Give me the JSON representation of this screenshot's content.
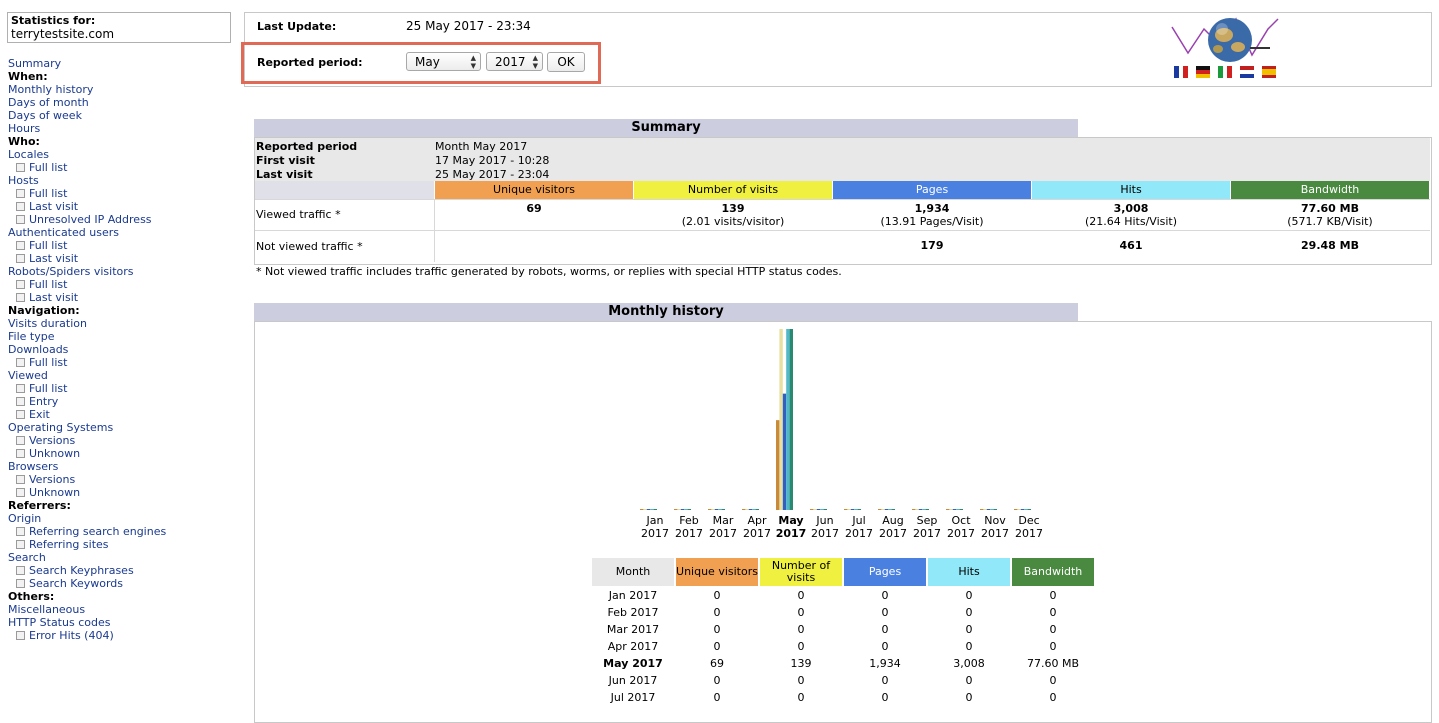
{
  "sidebar": {
    "stats_for_label": "Statistics for:",
    "site": "terrytestsite.com",
    "items": [
      {
        "label": "Summary",
        "type": "link"
      },
      {
        "label": "When:",
        "type": "head"
      },
      {
        "label": "Monthly history",
        "type": "link"
      },
      {
        "label": "Days of month",
        "type": "link"
      },
      {
        "label": "Days of week",
        "type": "link"
      },
      {
        "label": "Hours",
        "type": "link"
      },
      {
        "label": "Who:",
        "type": "head"
      },
      {
        "label": "Locales",
        "type": "link"
      },
      {
        "label": "Full list",
        "type": "sub"
      },
      {
        "label": "Hosts",
        "type": "link"
      },
      {
        "label": "Full list",
        "type": "sub"
      },
      {
        "label": "Last visit",
        "type": "sub"
      },
      {
        "label": "Unresolved IP Address",
        "type": "sub"
      },
      {
        "label": "Authenticated users",
        "type": "link"
      },
      {
        "label": "Full list",
        "type": "sub"
      },
      {
        "label": "Last visit",
        "type": "sub"
      },
      {
        "label": "Robots/Spiders visitors",
        "type": "link"
      },
      {
        "label": "Full list",
        "type": "sub"
      },
      {
        "label": "Last visit",
        "type": "sub"
      },
      {
        "label": "Navigation:",
        "type": "head"
      },
      {
        "label": "Visits duration",
        "type": "link"
      },
      {
        "label": "File type",
        "type": "link"
      },
      {
        "label": "Downloads",
        "type": "link"
      },
      {
        "label": "Full list",
        "type": "sub"
      },
      {
        "label": "Viewed",
        "type": "link"
      },
      {
        "label": "Full list",
        "type": "sub"
      },
      {
        "label": "Entry",
        "type": "sub"
      },
      {
        "label": "Exit",
        "type": "sub"
      },
      {
        "label": "Operating Systems",
        "type": "link"
      },
      {
        "label": "Versions",
        "type": "sub"
      },
      {
        "label": "Unknown",
        "type": "sub"
      },
      {
        "label": "Browsers",
        "type": "link"
      },
      {
        "label": "Versions",
        "type": "sub"
      },
      {
        "label": "Unknown",
        "type": "sub"
      },
      {
        "label": "Referrers:",
        "type": "head"
      },
      {
        "label": "Origin",
        "type": "link"
      },
      {
        "label": "Referring search engines",
        "type": "sub"
      },
      {
        "label": "Referring sites",
        "type": "sub"
      },
      {
        "label": "Search",
        "type": "link"
      },
      {
        "label": "Search Keyphrases",
        "type": "sub"
      },
      {
        "label": "Search Keywords",
        "type": "sub"
      },
      {
        "label": "Others:",
        "type": "head"
      },
      {
        "label": "Miscellaneous",
        "type": "link"
      },
      {
        "label": "HTTP Status codes",
        "type": "link"
      },
      {
        "label": "Error Hits (404)",
        "type": "sub"
      }
    ]
  },
  "top": {
    "last_update_label": "Last Update:",
    "last_update_value": "25 May 2017 - 23:34",
    "period_label": "Reported period:",
    "month_selected": "May",
    "year_selected": "2017",
    "ok_label": "OK",
    "flags": [
      "fr",
      "de",
      "it",
      "nl",
      "es"
    ]
  },
  "summary": {
    "title": "Summary",
    "reported_period_label": "Reported period",
    "reported_period_value": "Month May 2017",
    "first_visit_label": "First visit",
    "first_visit_value": "17 May 2017 - 10:28",
    "last_visit_label": "Last visit",
    "last_visit_value": "25 May 2017 - 23:04",
    "columns": [
      {
        "label": "Unique visitors",
        "color": "#f0a050"
      },
      {
        "label": "Number of visits",
        "color": "#f0f040"
      },
      {
        "label": "Pages",
        "color": "#4a80e0"
      },
      {
        "label": "Hits",
        "color": "#90e8f8"
      },
      {
        "label": "Bandwidth",
        "color": "#4a8a40"
      }
    ],
    "viewed_label": "Viewed traffic *",
    "viewed": [
      {
        "main": "69",
        "sub": ""
      },
      {
        "main": "139",
        "sub": "(2.01 visits/visitor)"
      },
      {
        "main": "1,934",
        "sub": "(13.91 Pages/Visit)"
      },
      {
        "main": "3,008",
        "sub": "(21.64 Hits/Visit)"
      },
      {
        "main": "77.60 MB",
        "sub": "(571.7 KB/Visit)"
      }
    ],
    "not_viewed_label": "Not viewed traffic *",
    "not_viewed": [
      "",
      "",
      "179",
      "461",
      "29.48 MB"
    ],
    "footnote": "* Not viewed traffic includes traffic generated by robots, worms, or replies with special HTTP status codes."
  },
  "monthly": {
    "title": "Monthly history",
    "months": [
      {
        "m": "Jan",
        "y": "2017"
      },
      {
        "m": "Feb",
        "y": "2017"
      },
      {
        "m": "Mar",
        "y": "2017"
      },
      {
        "m": "Apr",
        "y": "2017"
      },
      {
        "m": "May",
        "y": "2017",
        "current": true
      },
      {
        "m": "Jun",
        "y": "2017"
      },
      {
        "m": "Jul",
        "y": "2017"
      },
      {
        "m": "Aug",
        "y": "2017"
      },
      {
        "m": "Sep",
        "y": "2017"
      },
      {
        "m": "Oct",
        "y": "2017"
      },
      {
        "m": "Nov",
        "y": "2017"
      },
      {
        "m": "Dec",
        "y": "2017"
      }
    ],
    "table_headers": [
      {
        "label": "Month",
        "color": "#e8e8e8"
      },
      {
        "label": "Unique visitors",
        "color": "#f0a050"
      },
      {
        "label": "Number of visits",
        "color": "#f0f040"
      },
      {
        "label": "Pages",
        "color": "#4a80e0"
      },
      {
        "label": "Hits",
        "color": "#90e8f8"
      },
      {
        "label": "Bandwidth",
        "color": "#4a8a40"
      }
    ],
    "rows": [
      [
        "Jan 2017",
        "0",
        "0",
        "0",
        "0",
        "0"
      ],
      [
        "Feb 2017",
        "0",
        "0",
        "0",
        "0",
        "0"
      ],
      [
        "Mar 2017",
        "0",
        "0",
        "0",
        "0",
        "0"
      ],
      [
        "Apr 2017",
        "0",
        "0",
        "0",
        "0",
        "0"
      ],
      [
        "May 2017",
        "69",
        "139",
        "1,934",
        "3,008",
        "77.60 MB"
      ],
      [
        "Jun 2017",
        "0",
        "0",
        "0",
        "0",
        "0"
      ],
      [
        "Jul 2017",
        "0",
        "0",
        "0",
        "0",
        "0"
      ]
    ]
  },
  "chart_data": {
    "type": "bar",
    "categories": [
      "Jan",
      "Feb",
      "Mar",
      "Apr",
      "May",
      "Jun",
      "Jul",
      "Aug",
      "Sep",
      "Oct",
      "Nov",
      "Dec"
    ],
    "series": [
      {
        "name": "Unique visitors",
        "color": "#c98a3a",
        "values": [
          0,
          0,
          0,
          0,
          69,
          0,
          0,
          0,
          0,
          0,
          0,
          0
        ]
      },
      {
        "name": "Number of visits",
        "color": "#e8e0a0",
        "values": [
          0,
          0,
          0,
          0,
          139,
          0,
          0,
          0,
          0,
          0,
          0,
          0
        ]
      },
      {
        "name": "Pages",
        "color": "#3060c0",
        "values": [
          0,
          0,
          0,
          0,
          1934,
          0,
          0,
          0,
          0,
          0,
          0,
          0
        ]
      },
      {
        "name": "Hits",
        "color": "#50b8c8",
        "values": [
          0,
          0,
          0,
          0,
          3008,
          0,
          0,
          0,
          0,
          0,
          0,
          0
        ]
      },
      {
        "name": "Bandwidth",
        "color": "#2a8a70",
        "values": [
          0,
          0,
          0,
          0,
          77.6,
          0,
          0,
          0,
          0,
          0,
          0,
          0
        ]
      }
    ]
  }
}
